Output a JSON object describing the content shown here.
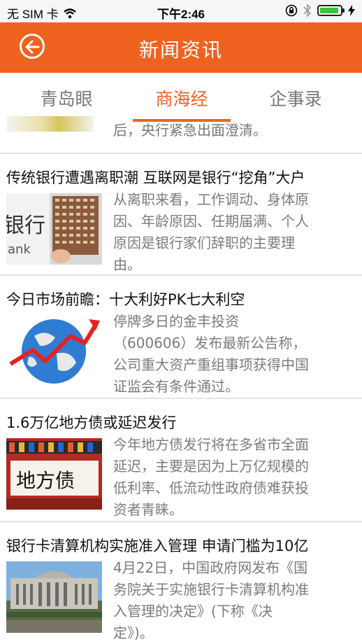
{
  "status_bar": {
    "carrier": "无 SIM 卡",
    "time": "下午2:46"
  },
  "header": {
    "title": "新闻资讯"
  },
  "tabs": [
    {
      "label": "青岛眼",
      "active": false
    },
    {
      "label": "商海经",
      "active": true
    },
    {
      "label": "企事录",
      "active": false
    }
  ],
  "partial_item": {
    "snippet": "后，央行紧急出面澄清。"
  },
  "items": [
    {
      "title": "传统银行遭遇离职潮 互联网是银行“挖角”大户",
      "image_icon": "bank-building-image",
      "snippet_lines": [
        "从离职来看，工作调动、身体原",
        "因、年龄原因、任期届满、个人",
        "原因是银行家们辞职的主要理",
        "由。"
      ]
    },
    {
      "title": "今日市场前瞻：十大利好PK七大利空",
      "image_icon": "globe-rising-arrow-image",
      "snippet_lines": [
        "停牌多日的金丰投资",
        "（600606）发布最新公告称，",
        "公司重大资产重组事项获得中国",
        "证监会有条件通过。"
      ]
    },
    {
      "title": "1.6万亿地方债或延迟发行",
      "image_icon": "local-debt-image",
      "image_text": "地方债",
      "snippet_lines": [
        "今年地方债发行将在多省市全面",
        "延迟，主要是因为上万亿规模的",
        "低利率、低流动性政府债难获投",
        "资者青睐。"
      ]
    },
    {
      "title": "银行卡清算机构实施准入管理 申请门槛为10亿",
      "image_icon": "central-bank-building-image",
      "snippet_lines": [
        "4月22日，中国政府网发布《国",
        "务院关于实施银行卡清算机构准",
        "入管理的决定》(下称《决",
        "定》)。"
      ]
    }
  ],
  "colors": {
    "accent": "#f0621f",
    "title_text": "#111111",
    "snippet_text": "#7b7b7b",
    "tab_inactive": "#777777"
  }
}
